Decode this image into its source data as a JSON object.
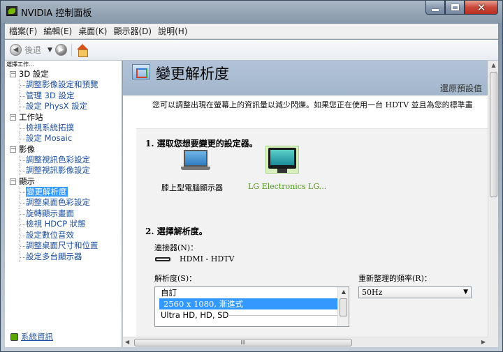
{
  "window": {
    "title": "NVIDIA 控制面板"
  },
  "menu": [
    "檔案(F)",
    "編輯(E)",
    "桌面(K)",
    "顯示器(D)",
    "說明(H)"
  ],
  "toolbar": {
    "back_label": "後退",
    "dropdown": "▼",
    "back_glyph": "◀",
    "forward_glyph": "▶"
  },
  "left": {
    "header": "選擇工作...",
    "categories": [
      {
        "label": "3D 設定",
        "items": [
          "調整影像設定和預覽",
          "管理 3D 設定",
          "設定 PhysX 設定"
        ]
      },
      {
        "label": "工作站",
        "items": [
          "檢視系統拓撲",
          "設定 Mosaic"
        ]
      },
      {
        "label": "影像",
        "items": [
          "調整視訊色彩設定",
          "調整視訊影像設定"
        ]
      },
      {
        "label": "顯示",
        "items": [
          "變更解析度",
          "調整桌面色彩設定",
          "旋轉顯示畫面",
          "檢視 HDCP 狀態",
          "設定數位音效",
          "調整桌面尺寸和位置",
          "設定多台顯示器"
        ]
      }
    ],
    "system_info": "系統資訊"
  },
  "main": {
    "title": "變更解析度",
    "restore": "還原預設值",
    "description": "您可以調整出現在螢幕上的資訊量以減少閃爍。如果您正在使用一台 HDTV 並且為您的標準畫",
    "section1": "1. 選取您想要變更的設定器。",
    "displays": [
      {
        "label": "膝上型電腦顯示器"
      },
      {
        "label": "LG Electronics LG..."
      }
    ],
    "section2": "2. 選擇解析度。",
    "connector_label": "連接器(N)：",
    "connector_value": "HDMI - HDTV",
    "resolution_label": "解析度(S)：",
    "resolution_list": [
      "自訂",
      "2560 x 1080, 漸進式",
      "Ultra HD, HD, SD"
    ],
    "refresh_label": "重新整理的頻率(R)：",
    "refresh_value": "50Hz",
    "hscroll_grip": "III"
  },
  "colors": {
    "selection": "#3399ff",
    "link": "#1b4fa1",
    "accent_green": "#76b900",
    "banner": "#a2b6cc"
  }
}
